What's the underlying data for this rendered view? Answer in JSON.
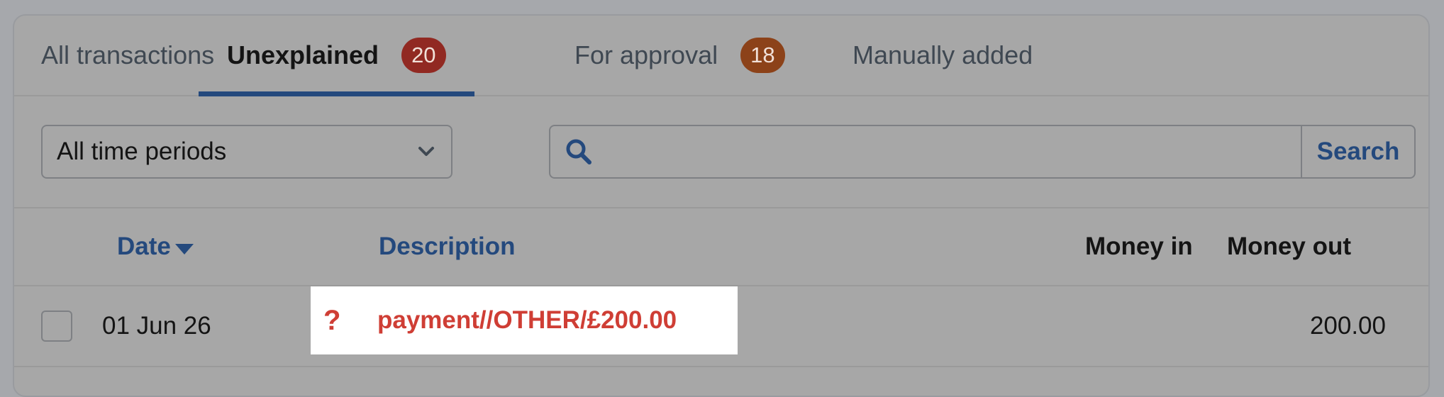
{
  "tabs": [
    {
      "label": "All transactions"
    },
    {
      "label": "Unexplained",
      "badge": "20",
      "badge_color": "#912922"
    },
    {
      "label": "For approval",
      "badge": "18",
      "badge_color": "#8c4219"
    },
    {
      "label": "Manually added"
    }
  ],
  "active_tab": "Unexplained",
  "filters": {
    "period_selected": "All time periods",
    "search_placeholder": "",
    "search_value": "",
    "search_button_label": "Search"
  },
  "table": {
    "columns": {
      "date": "Date",
      "description": "Description",
      "money_in": "Money in",
      "money_out": "Money out"
    },
    "sort": {
      "column": "Date",
      "direction": "descending"
    },
    "rows": [
      {
        "date": "01 Jun 26",
        "status_icon": "?",
        "description": "payment//OTHER/£200.00",
        "money_in": "",
        "money_out": "200.00"
      }
    ]
  },
  "colors": {
    "accent": "#24497d",
    "unexplained": "#cf3e35",
    "highlight": "#ffffff"
  },
  "icons": {
    "search": "search-icon",
    "dropdown": "chevron-down-icon",
    "sort": "sort-descending-icon",
    "status": "question-icon"
  }
}
